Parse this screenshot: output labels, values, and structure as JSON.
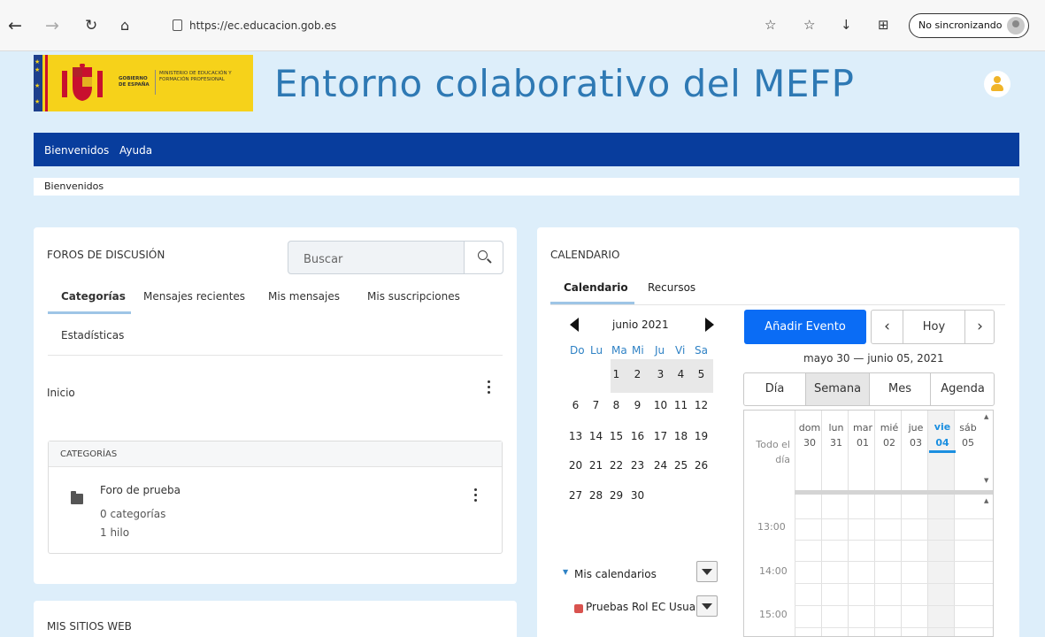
{
  "browser": {
    "url": "https://ec.educacion.gob.es",
    "sync_label": "No sincronizando"
  },
  "header": {
    "logo_gobierno": "GOBIERNO DE ESPAÑA",
    "logo_ministerio": "MINISTERIO DE EDUCACIÓN Y FORMACIÓN PROFESIONAL",
    "site_title": "Entorno colaborativo del MEFP"
  },
  "navbar": {
    "items": [
      "Bienvenidos",
      "Ayuda"
    ]
  },
  "breadcrumb": "Bienvenidos",
  "forums": {
    "title": "FOROS DE DISCUSIÓN",
    "search_placeholder": "Buscar",
    "tabs": [
      "Categorías",
      "Mensajes recientes",
      "Mis mensajes",
      "Mis suscripciones",
      "Estadísticas"
    ],
    "home_label": "Inicio",
    "categories_header": "CATEGORÍAS",
    "category": {
      "name": "Foro de prueba",
      "subcats": "0 categorías",
      "threads": "1 hilo"
    }
  },
  "websites": {
    "title": "MIS SITIOS WEB"
  },
  "calendar": {
    "title": "CALENDARIO",
    "tabs": [
      "Calendario",
      "Recursos"
    ],
    "mini": {
      "month": "junio 2021",
      "daynames": [
        "Do",
        "Lu",
        "Ma",
        "Mi",
        "Ju",
        "Vi",
        "Sa"
      ],
      "weeks": [
        [
          "",
          "",
          "1",
          "2",
          "3",
          "4",
          "5"
        ],
        [
          "6",
          "7",
          "8",
          "9",
          "10",
          "11",
          "12"
        ],
        [
          "13",
          "14",
          "15",
          "16",
          "17",
          "18",
          "19"
        ],
        [
          "20",
          "21",
          "22",
          "23",
          "24",
          "25",
          "26"
        ],
        [
          "27",
          "28",
          "29",
          "30",
          "",
          "",
          ""
        ]
      ]
    },
    "add_event": "Añadir Evento",
    "today_label": "Hoy",
    "range": "mayo 30 — junio 05, 2021",
    "views": [
      "Día",
      "Semana",
      "Mes",
      "Agenda"
    ],
    "week_days": [
      {
        "name": "dom",
        "num": "30"
      },
      {
        "name": "lun",
        "num": "31"
      },
      {
        "name": "mar",
        "num": "01"
      },
      {
        "name": "mié",
        "num": "02"
      },
      {
        "name": "jue",
        "num": "03"
      },
      {
        "name": "vie",
        "num": "04"
      },
      {
        "name": "sáb",
        "num": "05"
      }
    ],
    "all_day_label": "Todo el día",
    "times": [
      "13:00",
      "14:00",
      "15:00"
    ],
    "my_calendars": "Mis calendarios",
    "calendar_item": "Pruebas Rol EC Usuar",
    "calendar_item_color": "#d9534f"
  }
}
